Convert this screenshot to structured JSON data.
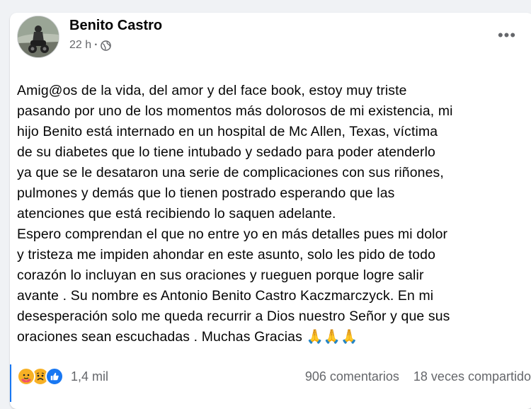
{
  "post": {
    "author": "Benito Castro",
    "time": "22 h",
    "dot": "·",
    "privacy_icon": "globe-icon",
    "more_icon": "more-options-icon",
    "more_label": "•••",
    "lines": [
      "Amig@os de la vida, del amor y del face book, estoy muy triste",
      "pasando por uno de los momentos más dolorosos de mi existencia, mi",
      "hijo Benito está internado en un hospital de Mc Allen, Texas, víctima",
      "de su diabetes que lo tiene intubado y sedado para poder atenderlo",
      "ya que se le desataron una serie de complicaciones con sus riñones,",
      "pulmones y demás que lo tienen postrado esperando que las",
      "atenciones que está recibiendo lo saquen adelante.",
      "Espero comprendan el que no entre yo en más detalles pues mi dolor",
      "y tristeza me impiden ahondar en este asunto, solo les pido de todo",
      "corazón lo incluyan en sus oraciones y rueguen porque logre salir",
      "avante . Su nombre es Antonio Benito Castro Kaczmarczyck. En mi",
      "desesperación solo me queda recurrir a Dios nuestro Señor y que sus",
      "oraciones sean escuchadas . Muchas Gracias 🙏🙏🙏"
    ]
  },
  "footer": {
    "reactions": [
      "care-reaction-icon",
      "sad-reaction-icon",
      "like-reaction-icon"
    ],
    "reaction_count": "1,4 mil",
    "comments": "906 comentarios",
    "shares": "18 veces compartido"
  },
  "colors": {
    "accent": "#1877f2",
    "text": "#050505",
    "secondary": "#65676b",
    "background": "#f0f2f5"
  }
}
